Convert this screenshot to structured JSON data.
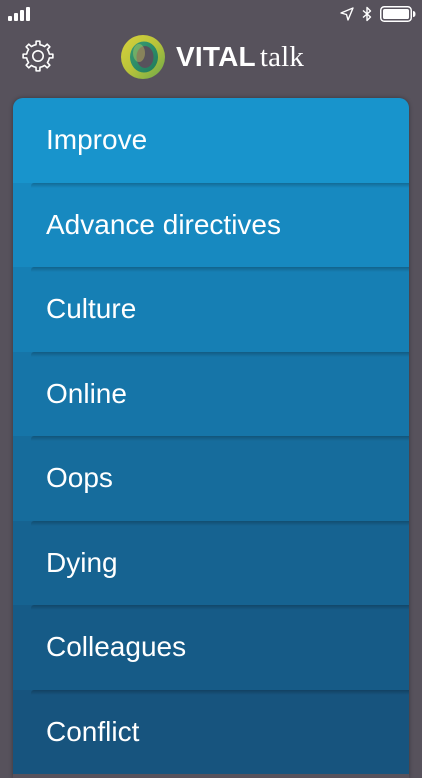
{
  "colors": {
    "background": "#57525c",
    "menu_top": "#1894cc",
    "menu_bottom": "#17547e",
    "text": "#ffffff",
    "logo_outer": "#c3cc3b",
    "logo_inner": "#2f8d6c"
  },
  "status_bar": {
    "icons": [
      "signal-icon",
      "location-arrow-icon",
      "bluetooth-icon",
      "battery-icon"
    ]
  },
  "header": {
    "settings_icon": "gear-icon",
    "logo": {
      "mark_icon": "vitaltalk-ring-icon",
      "bold": "VITAL",
      "light": "talk"
    }
  },
  "menu": {
    "items": [
      {
        "label": "Improve"
      },
      {
        "label": "Advance directives"
      },
      {
        "label": "Culture"
      },
      {
        "label": "Online"
      },
      {
        "label": "Oops"
      },
      {
        "label": "Dying"
      },
      {
        "label": "Colleagues"
      },
      {
        "label": "Conflict"
      }
    ]
  }
}
